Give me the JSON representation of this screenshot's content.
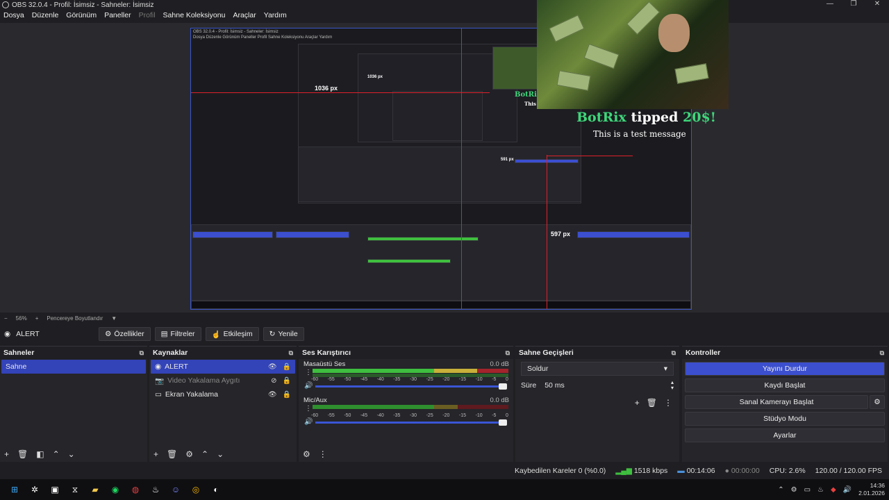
{
  "window": {
    "title": "OBS 32.0.4 - Profil: İsimsiz - Sahneler: İsimsiz",
    "controls": [
      "—",
      "❐",
      "✕"
    ]
  },
  "menu": {
    "file": "Dosya",
    "edit": "Düzenle",
    "view": "Görünüm",
    "docks": "Paneller",
    "profile": "Profil",
    "scene_collection": "Sahne Koleksiyonu",
    "tools": "Araçlar",
    "help": "Yardım"
  },
  "preview": {
    "nested_width_label": "1036 px",
    "nested_distance_label": "597 px",
    "nested_height_label": "591 px",
    "nested_width_small": "1036 px",
    "alert_user": "BotRix",
    "alert_action": " tipped ",
    "alert_amount": "20$!",
    "alert_message": "This is a test message",
    "alert_user_small": "BotRix",
    "alert_message_small": "This is"
  },
  "zoom": {
    "minus": "−",
    "value": "56%",
    "plus": "+",
    "fit": "Pencereye Boyutlandır",
    "arrow": "▼"
  },
  "source_toolbar": {
    "current_source": "ALERT",
    "properties": "Özellikler",
    "filters": "Filtreler",
    "interact": "Etkileşim",
    "refresh": "Yenile"
  },
  "scenes": {
    "title": "Sahneler",
    "items": [
      "Sahne"
    ]
  },
  "sources": {
    "title": "Kaynaklar",
    "items": [
      {
        "label": "ALERT",
        "icon": "browser-icon"
      },
      {
        "label": "Video Yakalama Aygıtı",
        "icon": "camera-icon"
      },
      {
        "label": "Ekran Yakalama",
        "icon": "monitor-icon"
      }
    ]
  },
  "mixer": {
    "title": "Ses Karıştırıcı",
    "channels": [
      {
        "name": "Masaüstü Ses",
        "db": "0.0 dB",
        "level": 0.94
      },
      {
        "name": "Mic/Aux",
        "db": "0.0 dB",
        "level": 0.74
      }
    ],
    "scale": [
      "-60",
      "-55",
      "-50",
      "-45",
      "-40",
      "-35",
      "-30",
      "-25",
      "-20",
      "-15",
      "-10",
      "-5",
      "0"
    ]
  },
  "transitions": {
    "title": "Sahne Geçişleri",
    "selected": "Soldur",
    "duration_label": "Süre",
    "duration_value": "50 ms"
  },
  "controls": {
    "title": "Kontroller",
    "stop_stream": "Yayını Durdur",
    "start_record": "Kaydı Başlat",
    "start_virtualcam": "Sanal Kamerayı Başlat",
    "studio_mode": "Stüdyo Modu",
    "settings": "Ayarlar"
  },
  "status": {
    "dropped_frames": "Kaybedilen Kareler 0 (%0.0)",
    "bitrate": "1518 kbps",
    "stream_time": "00:14:06",
    "record_time": "00:00:00",
    "cpu": "CPU: 2.6%",
    "fps": "120.00 / 120.00 FPS"
  },
  "taskbar": {
    "time": "14:36",
    "date": "2.01.2026",
    "apps": [
      "windows-start-icon",
      "settings-icon",
      "video-editor-icon",
      "capcut-icon",
      "file-explorer-icon",
      "spotify-icon",
      "screen-recorder-icon",
      "steam-icon",
      "discord-icon",
      "chrome-icon",
      "obs-icon"
    ]
  },
  "colors": {
    "accent": "#3343b8",
    "alert_green": "#3ed67a",
    "meter_green": "#3fbf3f",
    "meter_yellow": "#c8b03a",
    "meter_red": "#a3242c",
    "guide_red": "#e0202a"
  }
}
